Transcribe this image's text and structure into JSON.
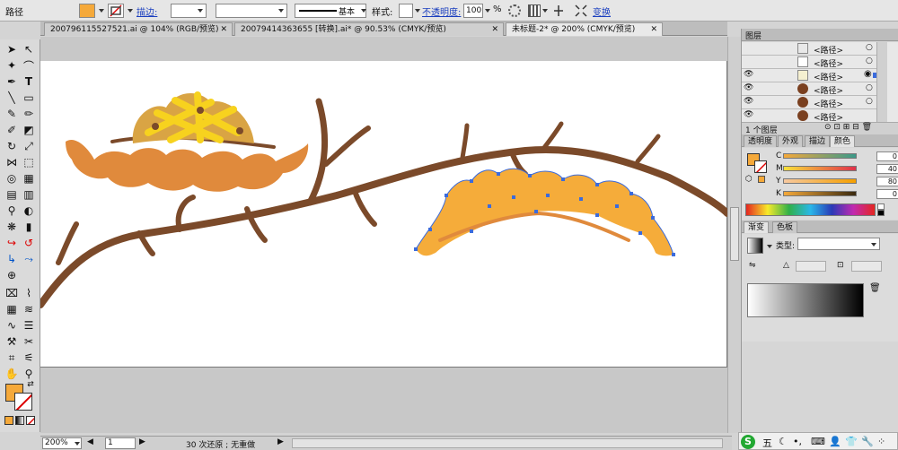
{
  "control_bar": {
    "object_type": "路径",
    "fill_color": "#f5a93a",
    "stroke_label": "描边:",
    "stroke_style_label": "基本",
    "style_label": "样式:",
    "opacity_label": "不透明度:",
    "opacity_value": "100",
    "opacity_unit": "%",
    "transform_label": "变换"
  },
  "tabs": [
    {
      "label": "200796115527521.ai @ 104% (RGB/预览)",
      "active": false
    },
    {
      "label": "20079414363655 [转换].ai* @ 90.53% (CMYK/预览)",
      "active": false
    },
    {
      "label": "未标题-2* @ 200% (CMYK/预览)",
      "active": true
    }
  ],
  "layers_panel": {
    "title": "图层",
    "rows": [
      {
        "name": "<路径>",
        "swatch": "#fffbe6"
      },
      {
        "name": "<路径>",
        "swatch": "#ffffff"
      },
      {
        "name": "<路径>",
        "swatch": "#f5f0d0"
      },
      {
        "name": "<路径>",
        "swatch": "#7a4020"
      },
      {
        "name": "<路径>",
        "swatch": "#7a4020"
      },
      {
        "name": "<路径>",
        "swatch": "#7a4020"
      }
    ],
    "footer": "1 个图层"
  },
  "color_panel": {
    "tabs": [
      "透明度",
      "外观",
      "描边",
      "颜色"
    ],
    "channels": [
      {
        "label": "C",
        "value": "0"
      },
      {
        "label": "M",
        "value": "40"
      },
      {
        "label": "Y",
        "value": "80"
      },
      {
        "label": "K",
        "value": "0"
      }
    ],
    "unit": "%",
    "fill_color": "#f5a93a"
  },
  "gradient_panel": {
    "tabs": [
      "渐变",
      "色板"
    ],
    "type_label": "类型:"
  },
  "status_bar": {
    "zoom": "200%",
    "page": "1",
    "undo_text": "30 次还原 ; 无重做"
  },
  "ime": {
    "label": "五"
  },
  "colors": {
    "branch": "#7b4a2a",
    "fruit_light": "#d9a444",
    "fruit_yellow": "#f7d21e",
    "leaf_orange": "#e08a3c",
    "selected_shape": "#f5ac3a",
    "selection_blue": "#3b6bdc"
  }
}
